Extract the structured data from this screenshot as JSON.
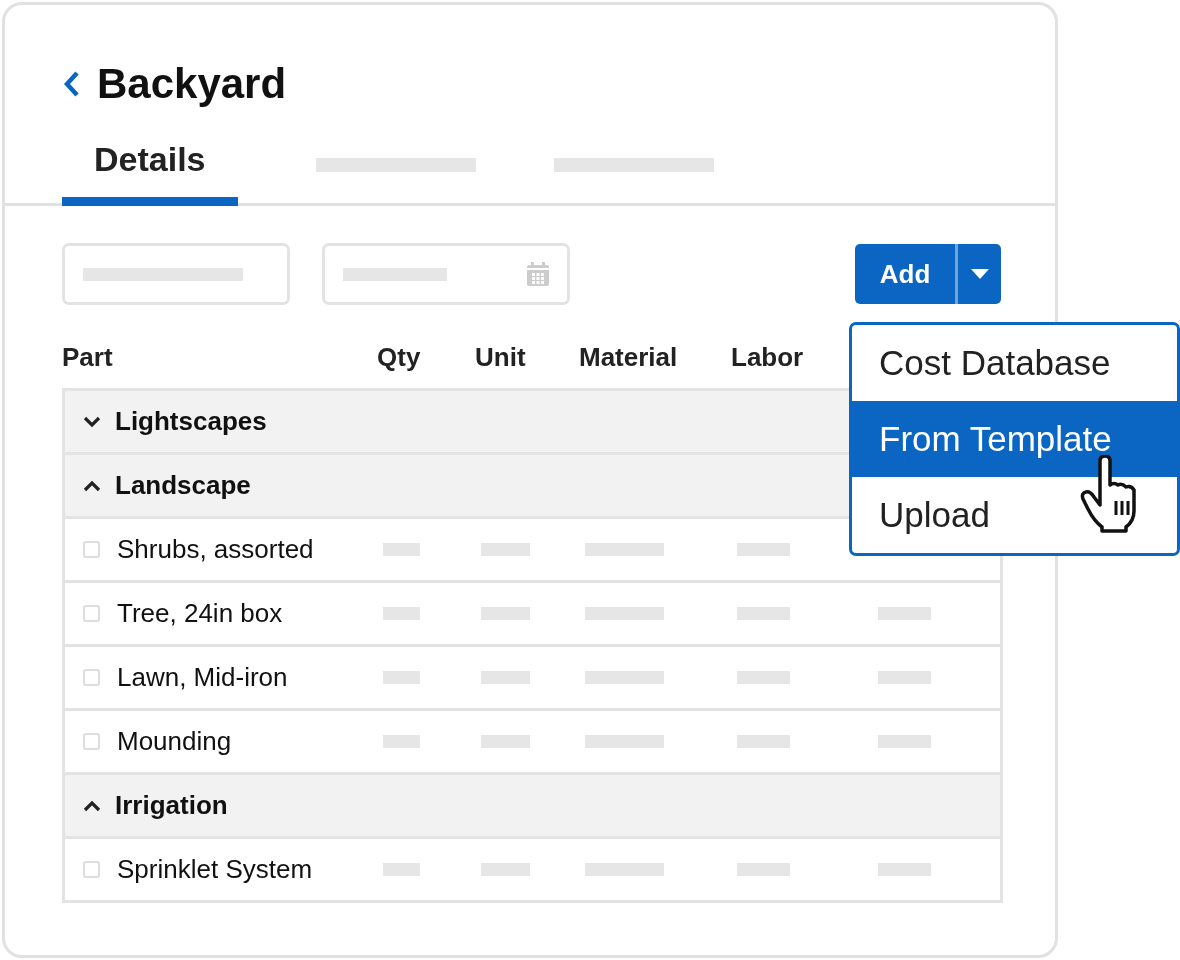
{
  "header": {
    "title": "Backyard"
  },
  "tabs": [
    {
      "kind": "text",
      "label": "Details",
      "selected": true
    },
    {
      "kind": "placeholder",
      "selected": false
    },
    {
      "kind": "placeholder",
      "selected": false
    }
  ],
  "filters": [
    {
      "kind": "text"
    },
    {
      "kind": "date"
    }
  ],
  "add_button": {
    "label": "Add",
    "menu_open": true
  },
  "add_menu": [
    {
      "label": "Cost Database",
      "selected": false
    },
    {
      "label": "From Template",
      "selected": true
    },
    {
      "label": "Upload",
      "selected": false
    }
  ],
  "table": {
    "columns": [
      "Part",
      "Qty",
      "Unit",
      "Material",
      "Labor"
    ],
    "groups": [
      {
        "name": "Lightscapes",
        "expanded": false
      },
      {
        "name": "Landscape",
        "expanded": true,
        "items": [
          {
            "name": "Shrubs, assorted",
            "checked": false
          },
          {
            "name": "Tree, 24in box",
            "checked": false
          },
          {
            "name": "Lawn, Mid-iron",
            "checked": false
          },
          {
            "name": "Mounding",
            "checked": false
          }
        ]
      },
      {
        "name": "Irrigation",
        "expanded": true,
        "items": [
          {
            "name": "Sprinklet System",
            "checked": false
          }
        ]
      }
    ]
  }
}
